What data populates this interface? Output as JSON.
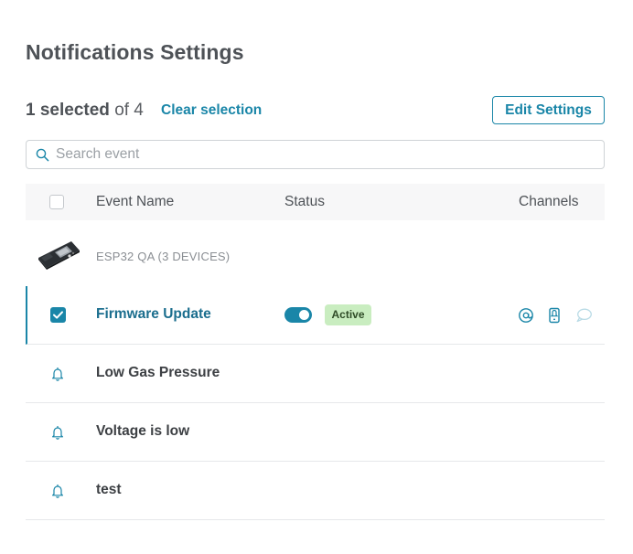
{
  "header": {
    "title": "Notifications Settings"
  },
  "selection": {
    "count": "1 selected",
    "total_text": "of 4",
    "clear_label": "Clear selection"
  },
  "toolbar": {
    "edit_label": "Edit Settings"
  },
  "search": {
    "placeholder": "Search event",
    "value": ""
  },
  "table": {
    "columns": [
      "Event Name",
      "Status",
      "Channels"
    ],
    "group": {
      "label": "ESP32 QA  (3 DEVICES)"
    },
    "rows": [
      {
        "name": "Firmware Update",
        "selected": true,
        "enabled": true,
        "status": "Active",
        "channels": [
          "email-icon",
          "push-icon",
          "sms-icon"
        ]
      },
      {
        "name": "Low Gas Pressure",
        "selected": false
      },
      {
        "name": "Voltage is low",
        "selected": false
      },
      {
        "name": "test",
        "selected": false
      }
    ]
  },
  "colors": {
    "accent": "#1a86a8",
    "active_badge_bg": "#c9edc0",
    "title": "#4e5257"
  }
}
